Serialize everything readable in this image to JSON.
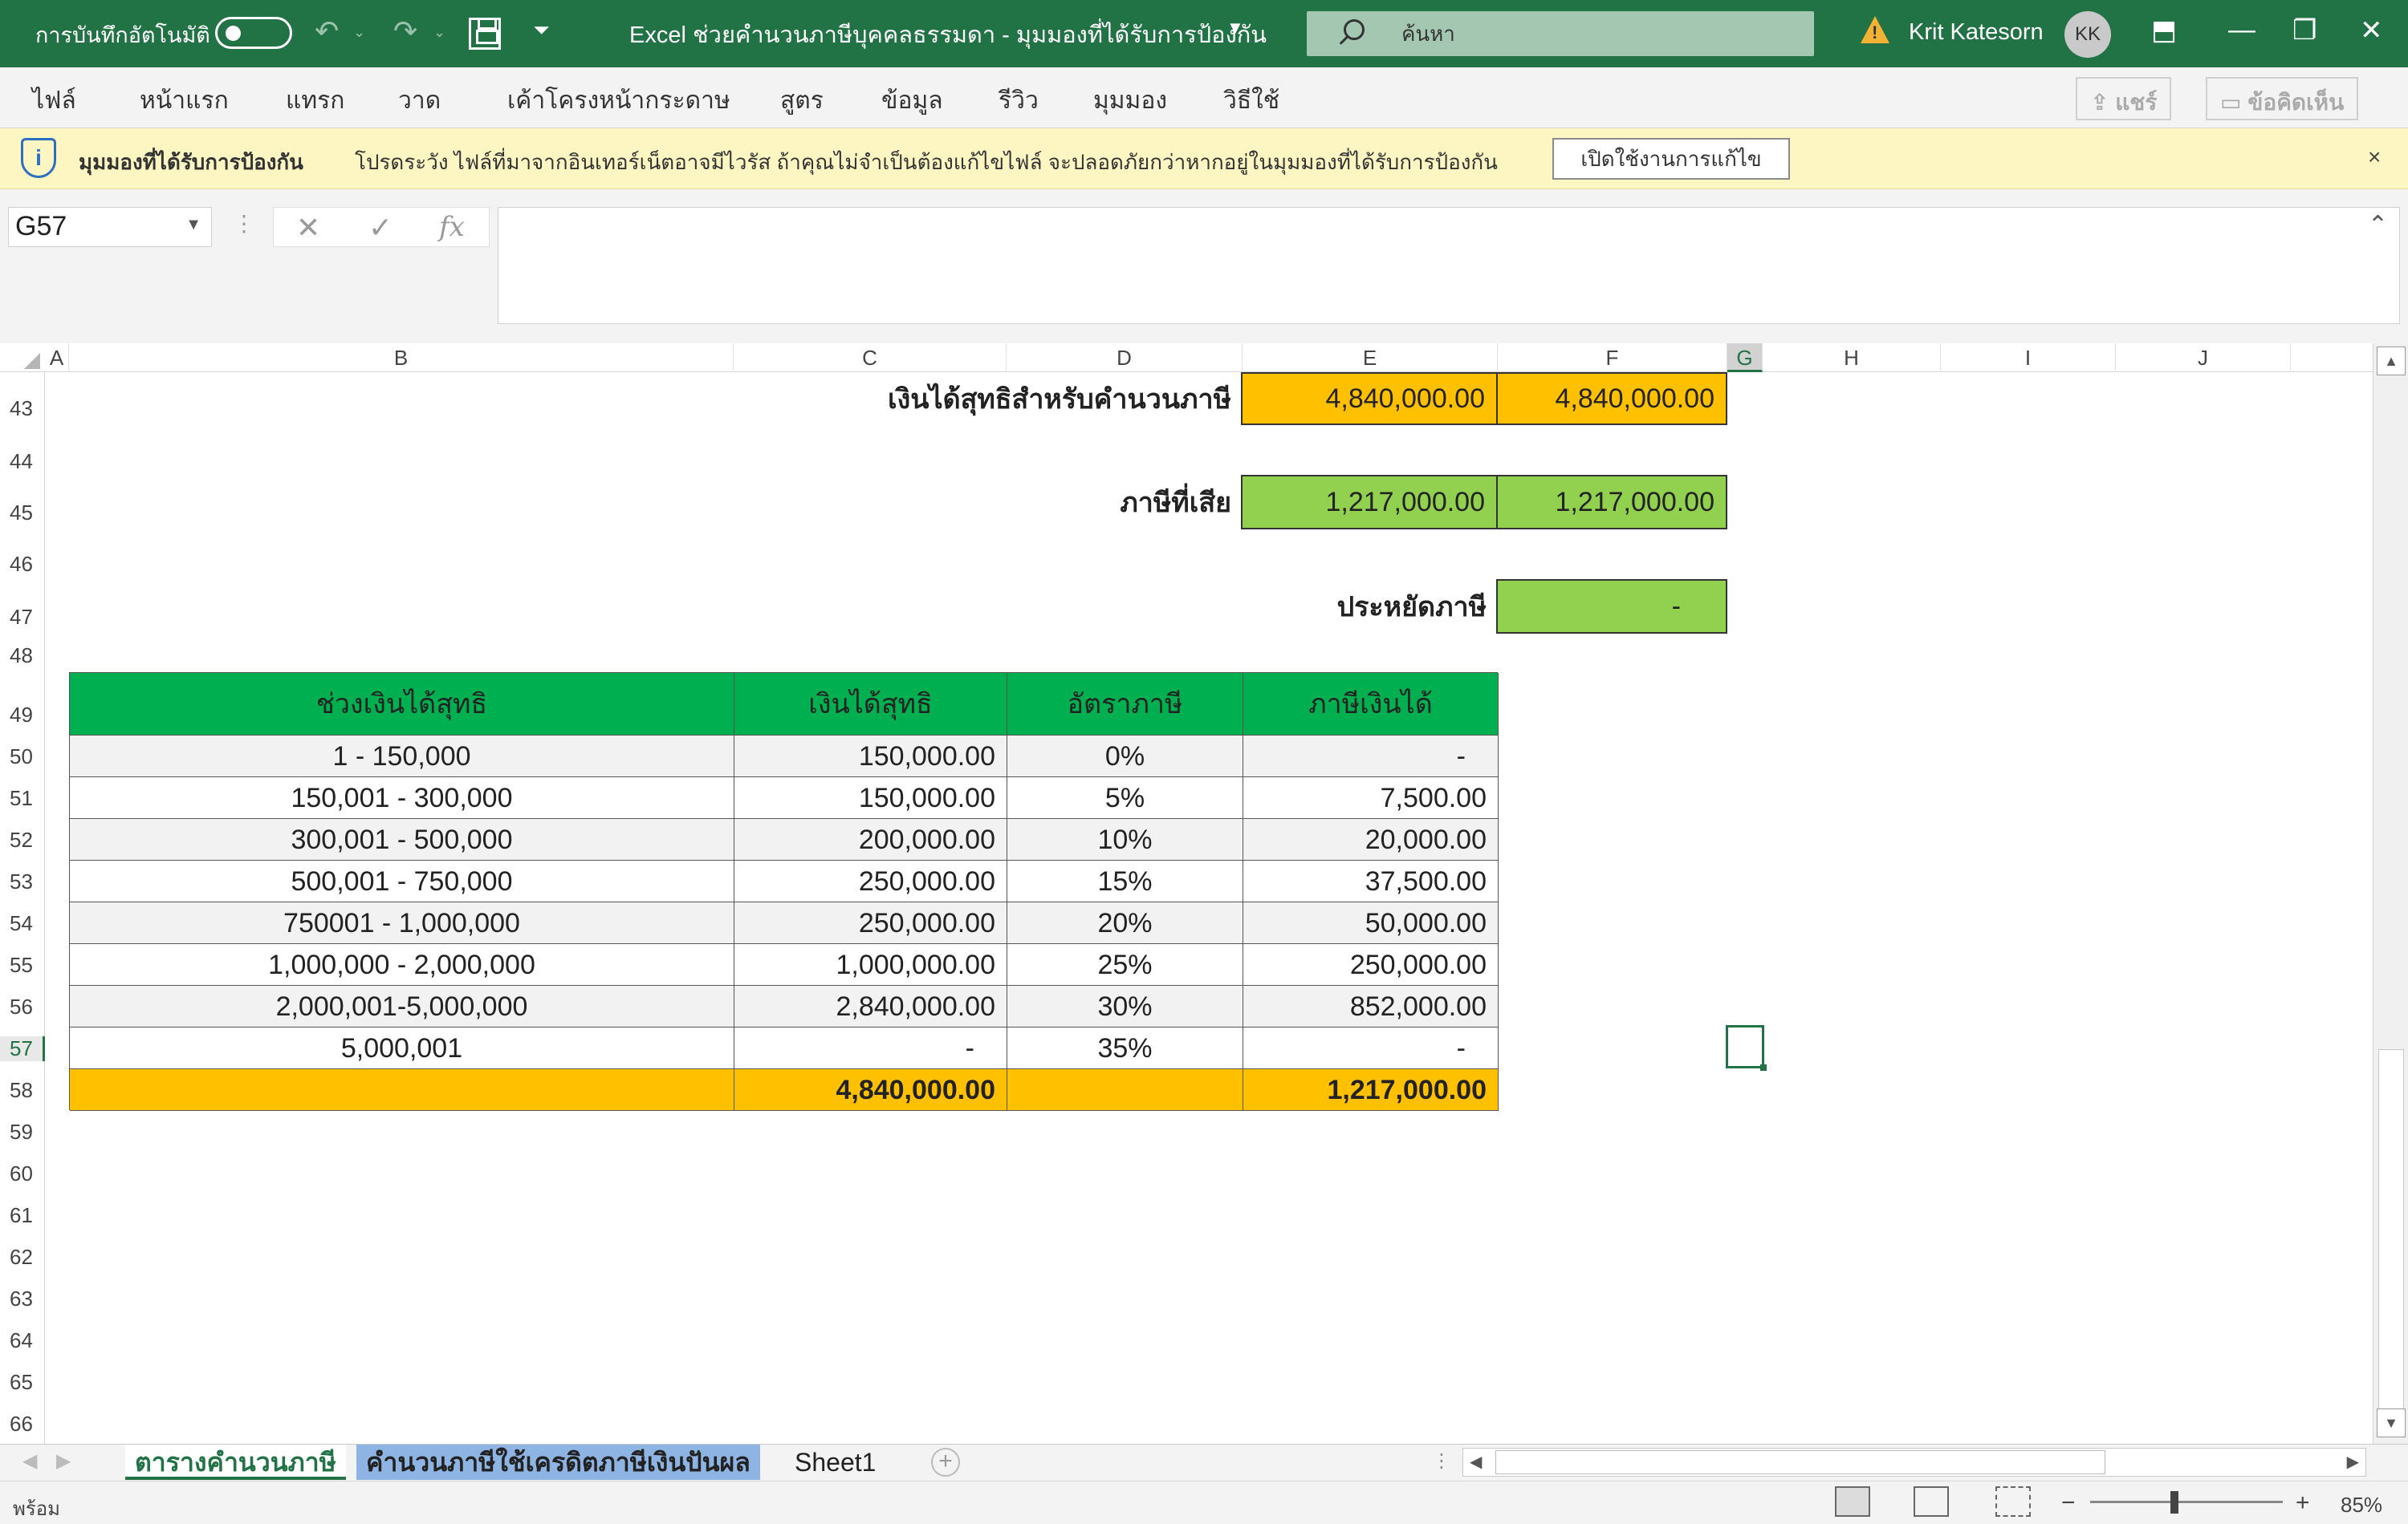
{
  "titlebar": {
    "autosave_label": "การบันทึกอัตโนมัติ",
    "autosave_state": "off",
    "doc_title": "Excel ช่วยคำนวนภาษีบุคคลธรรมดา  -  มุมมองที่ได้รับการป้องกัน",
    "search_placeholder": "ค้นหา",
    "user_name": "Krit Katesorn",
    "user_initials": "KK",
    "warning_symbol": "!"
  },
  "ribbon": {
    "tabs": [
      "ไฟล์",
      "หน้าแรก",
      "แทรก",
      "วาด",
      "เค้าโครงหน้ากระดาษ",
      "สูตร",
      "ข้อมูล",
      "รีวิว",
      "มุมมอง",
      "วิธีใช้"
    ],
    "share_label": "แชร์",
    "comments_label": "ข้อคิดเห็น"
  },
  "protected_view": {
    "title": "มุมมองที่ได้รับการป้องกัน",
    "message": "โปรดระวัง ไฟล์ที่มาจากอินเทอร์เน็ตอาจมีไวรัส ถ้าคุณไม่จำเป็นต้องแก้ไขไฟล์ จะปลอดภัยกว่าหากอยู่ในมุมมองที่ได้รับการป้องกัน",
    "enable_button": "เปิดใช้งานการแก้ไข",
    "close_symbol": "×"
  },
  "formula_bar": {
    "name_box": "G57",
    "fx_label": "fx",
    "cancel_symbol": "✕",
    "confirm_symbol": "✓",
    "content": ""
  },
  "columns": [
    "A",
    "B",
    "C",
    "D",
    "E",
    "F",
    "G",
    "H",
    "I",
    "J"
  ],
  "selected_column": "G",
  "rows": [
    "43",
    "44",
    "45",
    "46",
    "47",
    "48",
    "49",
    "50",
    "51",
    "52",
    "53",
    "54",
    "55",
    "56",
    "57",
    "58",
    "59",
    "60",
    "61",
    "62",
    "63",
    "64",
    "65",
    "66"
  ],
  "selected_row": "57",
  "summary": {
    "net_income_label": "เงินได้สุทธิสำหรับคำนวนภาษี",
    "net_income_e": "4,840,000.00",
    "net_income_f": "4,840,000.00",
    "tax_label": "ภาษีที่เสีย",
    "tax_e": "1,217,000.00",
    "tax_f": "1,217,000.00",
    "saving_label": "ประหยัดภาษี",
    "saving_f": "-"
  },
  "tax_table": {
    "headers": [
      "ช่วงเงินได้สุทธิ",
      "เงินได้สุทธิ",
      "อัตราภาษี",
      "ภาษีเงินได้"
    ],
    "rows": [
      [
        "1 - 150,000",
        "150,000.00",
        "0%",
        "-"
      ],
      [
        "150,001 - 300,000",
        "150,000.00",
        "5%",
        "7,500.00"
      ],
      [
        "300,001 - 500,000",
        "200,000.00",
        "10%",
        "20,000.00"
      ],
      [
        "500,001 - 750,000",
        "250,000.00",
        "15%",
        "37,500.00"
      ],
      [
        "750001 - 1,000,000",
        "250,000.00",
        "20%",
        "50,000.00"
      ],
      [
        "1,000,000 - 2,000,000",
        "1,000,000.00",
        "25%",
        "250,000.00"
      ],
      [
        "2,000,001-5,000,000",
        "2,840,000.00",
        "30%",
        "852,000.00"
      ],
      [
        "5,000,001",
        "-",
        "35%",
        "-"
      ]
    ],
    "total_income": "4,840,000.00",
    "total_tax": "1,217,000.00"
  },
  "sheets": {
    "tabs": [
      "ตารางคำนวนภาษี",
      "คำนวนภาษีใช้เครดิตภาษีเงินปันผล",
      "Sheet1"
    ],
    "active": "ตารางคำนวนภาษี",
    "colors": {
      "ตารางคำนวนภาษี": "#ffffff",
      "คำนวนภาษีใช้เครดิตภาษีเงินปันผล": "#8db4e2"
    }
  },
  "status": {
    "ready": "พร้อม",
    "zoom": "85%",
    "zoom_level": 0.85
  },
  "colors": {
    "title_green": "#217346",
    "header_green": "#00b050",
    "light_green": "#92d050",
    "orange": "#ffc000",
    "protected_yellow": "#fdf6c3"
  }
}
